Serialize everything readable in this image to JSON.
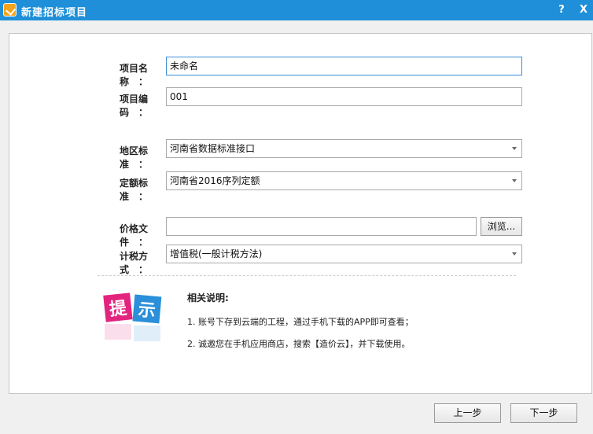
{
  "window": {
    "title": "新建招标项目",
    "help_label": "?",
    "close_label": "X"
  },
  "form": {
    "project_name": {
      "label": "项目名称",
      "value": "未命名"
    },
    "project_code": {
      "label": "项目编码",
      "value": "001"
    },
    "region_standard": {
      "label": "地区标准",
      "value": "河南省数据标准接口"
    },
    "quota_standard": {
      "label": "定额标准",
      "value": "河南省2016序列定额"
    },
    "price_file": {
      "label": "价格文件",
      "value": "",
      "browse_label": "浏览..."
    },
    "tax_method": {
      "label": "计税方式",
      "value": "增值税(一般计税方法)"
    },
    "colon": "："
  },
  "hint": {
    "icon_text_1": "提",
    "icon_text_2": "示",
    "title": "相关说明:",
    "lines": [
      "1.  账号下存到云端的工程，通过手机下载的APP即可查看；",
      "2.  诚邀您在手机应用商店，搜索【造价云】，并下载使用。"
    ]
  },
  "footer": {
    "prev_label": "上一步",
    "next_label": "下一步"
  },
  "colors": {
    "titlebar": "#1e8fd8",
    "focus_border": "#3a8fd6",
    "hint_pink": "#e3247e",
    "hint_blue": "#2b8fd9"
  }
}
